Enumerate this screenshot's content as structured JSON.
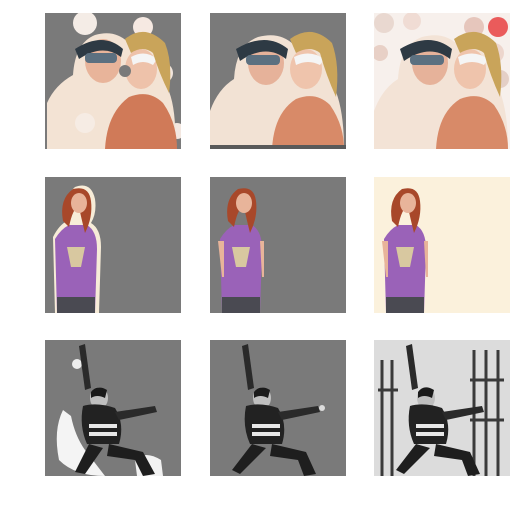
{
  "figure": {
    "rows": [
      {
        "subject": "two-women-with-masks",
        "columns": [
          "segmentation-with-artifacts",
          "segmentation-clean",
          "original-photo"
        ]
      },
      {
        "subject": "woman-in-purple-tshirt",
        "columns": [
          "segmentation-with-halo",
          "segmentation-clean",
          "original-photo"
        ]
      },
      {
        "subject": "dancer-black-and-white",
        "columns": [
          "segmentation-with-artifacts",
          "segmentation-clean",
          "original-photo"
        ]
      }
    ]
  },
  "colors": {
    "gray_background": "#7a7a7a",
    "page_background": "#ffffff",
    "cream_background": "#fbf1dc",
    "purple_shirt": "#9a62b8",
    "hair_red": "#a8482a",
    "skin": "#e8b49a"
  }
}
